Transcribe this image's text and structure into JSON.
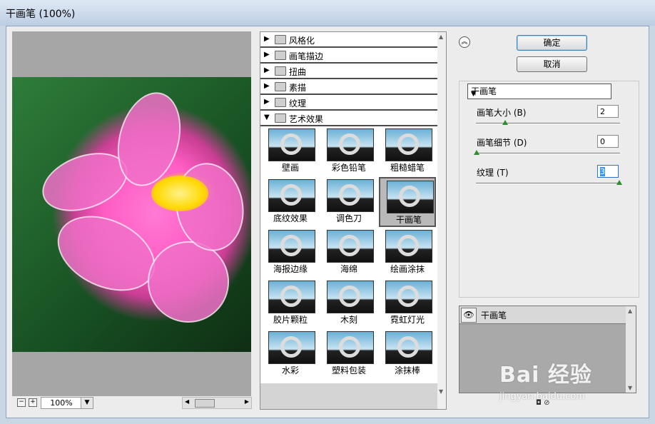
{
  "window": {
    "title": "干画笔 (100%)"
  },
  "preview": {
    "zoom": "100%",
    "zoom_out": "−",
    "zoom_in": "+"
  },
  "categories": [
    {
      "label": "风格化",
      "expanded": false
    },
    {
      "label": "画笔描边",
      "expanded": false
    },
    {
      "label": "扭曲",
      "expanded": false
    },
    {
      "label": "素描",
      "expanded": false
    },
    {
      "label": "纹理",
      "expanded": false
    },
    {
      "label": "艺术效果",
      "expanded": true
    }
  ],
  "filters": [
    {
      "label": "壁画"
    },
    {
      "label": "彩色铅笔"
    },
    {
      "label": "粗糙蜡笔"
    },
    {
      "label": "底纹效果"
    },
    {
      "label": "调色刀"
    },
    {
      "label": "干画笔",
      "selected": true
    },
    {
      "label": "海报边缘"
    },
    {
      "label": "海绵"
    },
    {
      "label": "绘画涂抹"
    },
    {
      "label": "胶片颗粒"
    },
    {
      "label": "木刻"
    },
    {
      "label": "霓虹灯光"
    },
    {
      "label": "水彩"
    },
    {
      "label": "塑料包装"
    },
    {
      "label": "涂抹棒"
    }
  ],
  "buttons": {
    "ok": "确定",
    "cancel": "取消"
  },
  "filter_select": "干画笔",
  "params": [
    {
      "label": "画笔大小 (B)",
      "value": "2",
      "level": 0.2
    },
    {
      "label": "画笔细节 (D)",
      "value": "0",
      "level": 0.0
    },
    {
      "label": "纹理 (T)",
      "value": "3",
      "level": 1.0
    }
  ],
  "layers": [
    {
      "name": "干画笔"
    }
  ],
  "watermark": {
    "logo": "Bai 经验",
    "url": "jingyan.baidu.com"
  },
  "colors": {
    "selected_cell": "#b9b9b9",
    "slider_knob": "#2d8f2d",
    "ok_border": "#3c7fb1"
  }
}
